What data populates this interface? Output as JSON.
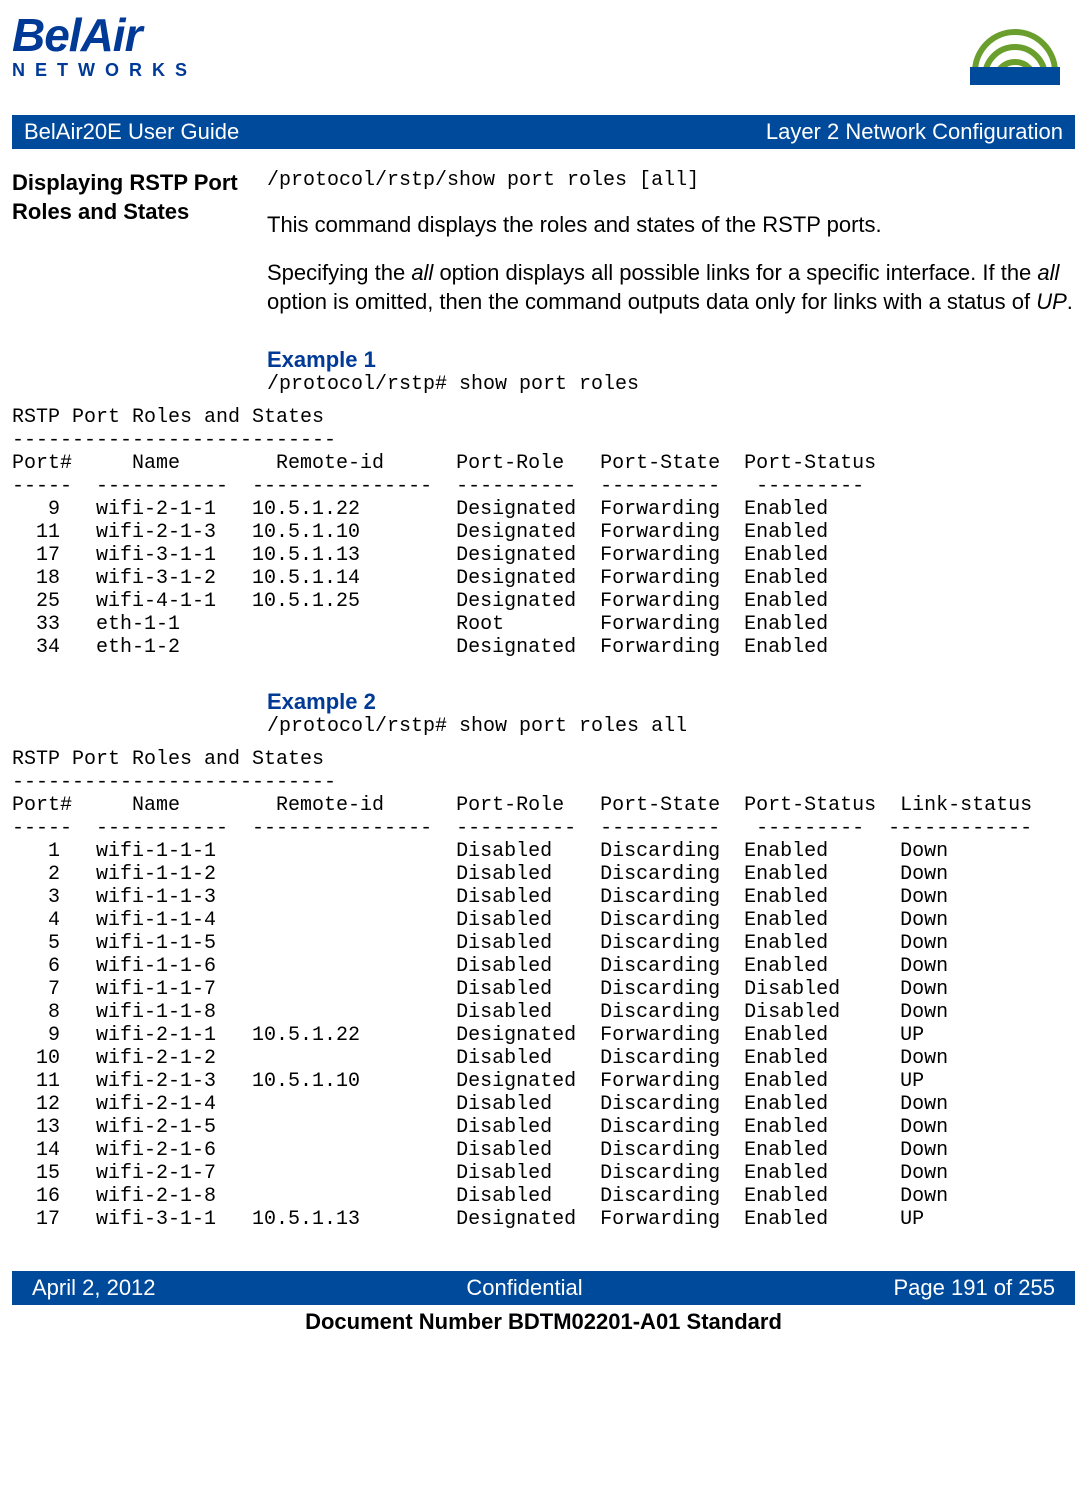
{
  "header": {
    "logo_top": "BelAir",
    "logo_bottom": "NETWORKS",
    "guide_title": "BelAir20E User Guide",
    "chapter_title": "Layer 2 Network Configuration"
  },
  "section": {
    "title": "Displaying RSTP Port Roles and States",
    "command": "/protocol/rstp/show port roles [all]",
    "desc1": "This command displays the roles and states of the RSTP ports.",
    "desc2_pre": "Specifying the ",
    "desc2_it1": "all",
    "desc2_mid": " option displays all possible links for a specific interface. If the ",
    "desc2_it2": "all",
    "desc2_mid2": " option is omitted, then the command outputs data only for links with a status of ",
    "desc2_it3": "UP",
    "desc2_end": "."
  },
  "example1": {
    "heading": "Example 1",
    "cmd": "/protocol/rstp# show port roles",
    "output_title": "RSTP Port Roles and States",
    "dash_title": "---------------------------",
    "headers": [
      "Port#",
      "Name",
      "Remote-id",
      "Port-Role",
      "Port-State",
      "Port-Status"
    ],
    "dash_headers": [
      "-----",
      "-----------",
      "---------------",
      "----------",
      "----------",
      "---------"
    ],
    "rows": [
      {
        "port": "9",
        "name": "wifi-2-1-1",
        "remote": "10.5.1.22",
        "role": "Designated",
        "state": "Forwarding",
        "status": "Enabled"
      },
      {
        "port": "11",
        "name": "wifi-2-1-3",
        "remote": "10.5.1.10",
        "role": "Designated",
        "state": "Forwarding",
        "status": "Enabled"
      },
      {
        "port": "17",
        "name": "wifi-3-1-1",
        "remote": "10.5.1.13",
        "role": "Designated",
        "state": "Forwarding",
        "status": "Enabled"
      },
      {
        "port": "18",
        "name": "wifi-3-1-2",
        "remote": "10.5.1.14",
        "role": "Designated",
        "state": "Forwarding",
        "status": "Enabled"
      },
      {
        "port": "25",
        "name": "wifi-4-1-1",
        "remote": "10.5.1.25",
        "role": "Designated",
        "state": "Forwarding",
        "status": "Enabled"
      },
      {
        "port": "33",
        "name": "eth-1-1",
        "remote": "",
        "role": "Root",
        "state": "Forwarding",
        "status": "Enabled"
      },
      {
        "port": "34",
        "name": "eth-1-2",
        "remote": "",
        "role": "Designated",
        "state": "Forwarding",
        "status": "Enabled"
      }
    ]
  },
  "example2": {
    "heading": "Example 2",
    "cmd": "/protocol/rstp# show port roles all",
    "output_title": "RSTP Port Roles and States",
    "dash_title": "---------------------------",
    "headers": [
      "Port#",
      "Name",
      "Remote-id",
      "Port-Role",
      "Port-State",
      "Port-Status",
      "Link-status"
    ],
    "dash_headers": [
      "-----",
      "-----------",
      "---------------",
      "----------",
      "----------",
      "---------",
      "------------"
    ],
    "rows": [
      {
        "port": "1",
        "name": "wifi-1-1-1",
        "remote": "",
        "role": "Disabled",
        "state": "Discarding",
        "status": "Enabled",
        "link": "Down"
      },
      {
        "port": "2",
        "name": "wifi-1-1-2",
        "remote": "",
        "role": "Disabled",
        "state": "Discarding",
        "status": "Enabled",
        "link": "Down"
      },
      {
        "port": "3",
        "name": "wifi-1-1-3",
        "remote": "",
        "role": "Disabled",
        "state": "Discarding",
        "status": "Enabled",
        "link": "Down"
      },
      {
        "port": "4",
        "name": "wifi-1-1-4",
        "remote": "",
        "role": "Disabled",
        "state": "Discarding",
        "status": "Enabled",
        "link": "Down"
      },
      {
        "port": "5",
        "name": "wifi-1-1-5",
        "remote": "",
        "role": "Disabled",
        "state": "Discarding",
        "status": "Enabled",
        "link": "Down"
      },
      {
        "port": "6",
        "name": "wifi-1-1-6",
        "remote": "",
        "role": "Disabled",
        "state": "Discarding",
        "status": "Enabled",
        "link": "Down"
      },
      {
        "port": "7",
        "name": "wifi-1-1-7",
        "remote": "",
        "role": "Disabled",
        "state": "Discarding",
        "status": "Disabled",
        "link": "Down"
      },
      {
        "port": "8",
        "name": "wifi-1-1-8",
        "remote": "",
        "role": "Disabled",
        "state": "Discarding",
        "status": "Disabled",
        "link": "Down"
      },
      {
        "port": "9",
        "name": "wifi-2-1-1",
        "remote": "10.5.1.22",
        "role": "Designated",
        "state": "Forwarding",
        "status": "Enabled",
        "link": "UP"
      },
      {
        "port": "10",
        "name": "wifi-2-1-2",
        "remote": "",
        "role": "Disabled",
        "state": "Discarding",
        "status": "Enabled",
        "link": "Down"
      },
      {
        "port": "11",
        "name": "wifi-2-1-3",
        "remote": "10.5.1.10",
        "role": "Designated",
        "state": "Forwarding",
        "status": "Enabled",
        "link": "UP"
      },
      {
        "port": "12",
        "name": "wifi-2-1-4",
        "remote": "",
        "role": "Disabled",
        "state": "Discarding",
        "status": "Enabled",
        "link": "Down"
      },
      {
        "port": "13",
        "name": "wifi-2-1-5",
        "remote": "",
        "role": "Disabled",
        "state": "Discarding",
        "status": "Enabled",
        "link": "Down"
      },
      {
        "port": "14",
        "name": "wifi-2-1-6",
        "remote": "",
        "role": "Disabled",
        "state": "Discarding",
        "status": "Enabled",
        "link": "Down"
      },
      {
        "port": "15",
        "name": "wifi-2-1-7",
        "remote": "",
        "role": "Disabled",
        "state": "Discarding",
        "status": "Enabled",
        "link": "Down"
      },
      {
        "port": "16",
        "name": "wifi-2-1-8",
        "remote": "",
        "role": "Disabled",
        "state": "Discarding",
        "status": "Enabled",
        "link": "Down"
      },
      {
        "port": "17",
        "name": "wifi-3-1-1",
        "remote": "10.5.1.13",
        "role": "Designated",
        "state": "Forwarding",
        "status": "Enabled",
        "link": "UP"
      }
    ]
  },
  "footer": {
    "date": "April 2, 2012",
    "confidential": "Confidential",
    "page": "Page 191 of 255",
    "docnum": "Document Number BDTM02201-A01 Standard"
  }
}
